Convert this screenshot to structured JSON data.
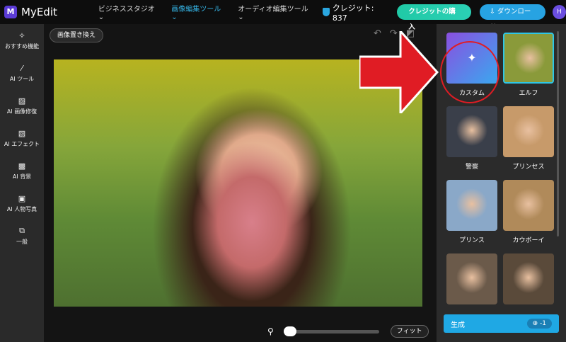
{
  "header": {
    "logo": "MyEdit",
    "nav": [
      "ビジネススタジオ",
      "画像編集ツール",
      "オーディオ編集ツール"
    ],
    "credits": "クレジット: 837",
    "buy": "クレジットの購入",
    "download": "ダウンロード",
    "avatar": "H"
  },
  "sidebar": {
    "items": [
      {
        "label": "おすすめ機能",
        "icon": "sparkle-icon"
      },
      {
        "label": "AI ツール",
        "icon": "magic-wand-icon"
      },
      {
        "label": "AI 画像修復",
        "icon": "image-repair-icon"
      },
      {
        "label": "AI エフェクト",
        "icon": "image-effect-icon"
      },
      {
        "label": "AI 背景",
        "icon": "background-icon"
      },
      {
        "label": "AI 人物写真",
        "icon": "portrait-icon"
      },
      {
        "label": "一般",
        "icon": "layers-icon"
      }
    ]
  },
  "canvas": {
    "replace_button": "画像置き換え",
    "fit": "フィット",
    "zoom_level": 0
  },
  "panel": {
    "styles": [
      {
        "label": "カスタム",
        "color": "#7a5ce6"
      },
      {
        "label": "エルフ",
        "color": "#8a9a3a"
      },
      {
        "label": "警察",
        "color": "#3a3f4a"
      },
      {
        "label": "プリンセス",
        "color": "#c79a6a"
      },
      {
        "label": "プリンス",
        "color": "#8aa8c8"
      },
      {
        "label": "カウボーイ",
        "color": "#b08a5a"
      },
      {
        "label": "",
        "color": "#6b5a4a"
      },
      {
        "label": "",
        "color": "#5a4a3a"
      }
    ],
    "generate": "生成",
    "cost": "-1"
  },
  "annotation_color": "#e01c24"
}
